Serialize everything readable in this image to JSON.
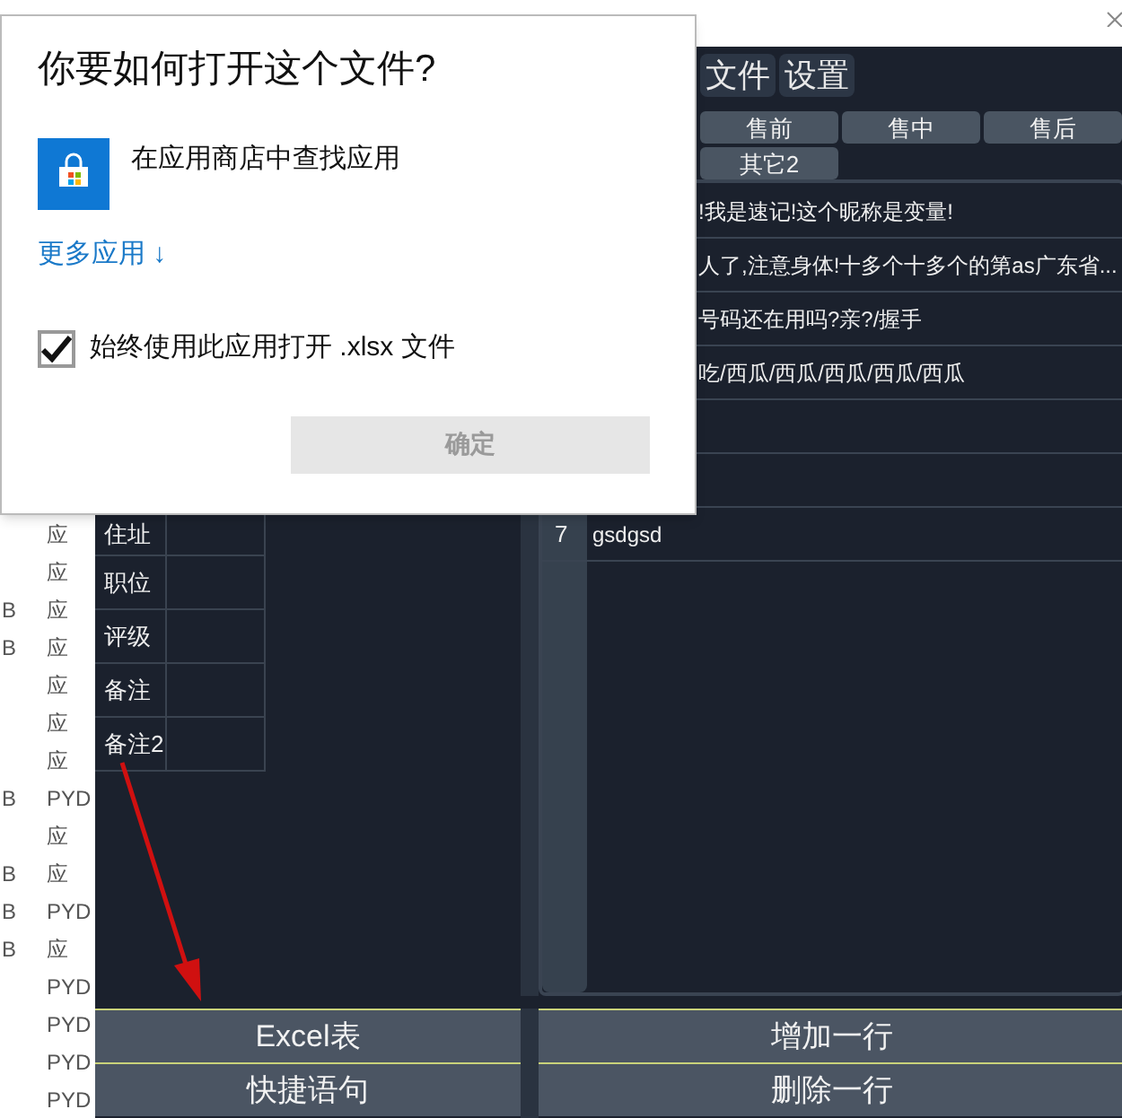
{
  "explorer": {
    "items": [
      {
        "name": "应"
      },
      {
        "name": "应"
      },
      {
        "name": "应",
        "size": "B"
      },
      {
        "name": "应",
        "size": "B"
      },
      {
        "name": "应"
      },
      {
        "name": "应"
      },
      {
        "name": "应"
      },
      {
        "name": "PYD",
        "size": "B"
      },
      {
        "name": "应"
      },
      {
        "name": "应",
        "size": "B"
      },
      {
        "name": "PYD",
        "size": "B"
      },
      {
        "name": "应",
        "size": "B"
      },
      {
        "name": "PYD"
      },
      {
        "name": "PYD"
      },
      {
        "name": "PYD"
      },
      {
        "name": "PYD"
      }
    ]
  },
  "app": {
    "menu": [
      {
        "label": "文件"
      },
      {
        "label": "设置"
      }
    ],
    "categories": [
      {
        "label": "售前"
      },
      {
        "label": "售中"
      },
      {
        "label": "售后"
      },
      {
        "label": "其它2"
      }
    ],
    "fields": [
      {
        "label": "住址"
      },
      {
        "label": "职位"
      },
      {
        "label": "评级"
      },
      {
        "label": "备注"
      },
      {
        "label": "备注2"
      }
    ],
    "phrases": [
      {
        "kind": "phrase",
        "text": "!我是速记!这个昵称是变量!"
      },
      {
        "kind": "phrase",
        "text": "人了,注意身体!十多个十多个的第as广东省..."
      },
      {
        "kind": "phrase",
        "text": "号码还在用吗?亲?/握手"
      },
      {
        "kind": "phrase",
        "text": "吃/西瓜/西瓜/西瓜/西瓜/西瓜"
      },
      {
        "kind": "blank"
      },
      {
        "kind": "blank"
      },
      {
        "kind": "phrase",
        "number": "7",
        "text": "gsdgsd"
      }
    ],
    "left_buttons": [
      "Excel表",
      "快捷语句"
    ],
    "right_buttons": [
      "增加一行",
      "删除一行"
    ]
  },
  "dialog": {
    "title": "你要如何打开这个文件?",
    "store_option": "在应用商店中查找应用",
    "more_apps": "更多应用 ↓",
    "checkbox": {
      "label": "始终使用此应用打开 .xlsx 文件",
      "checked": true
    },
    "confirm": {
      "label": "确定",
      "disabled": true
    }
  }
}
